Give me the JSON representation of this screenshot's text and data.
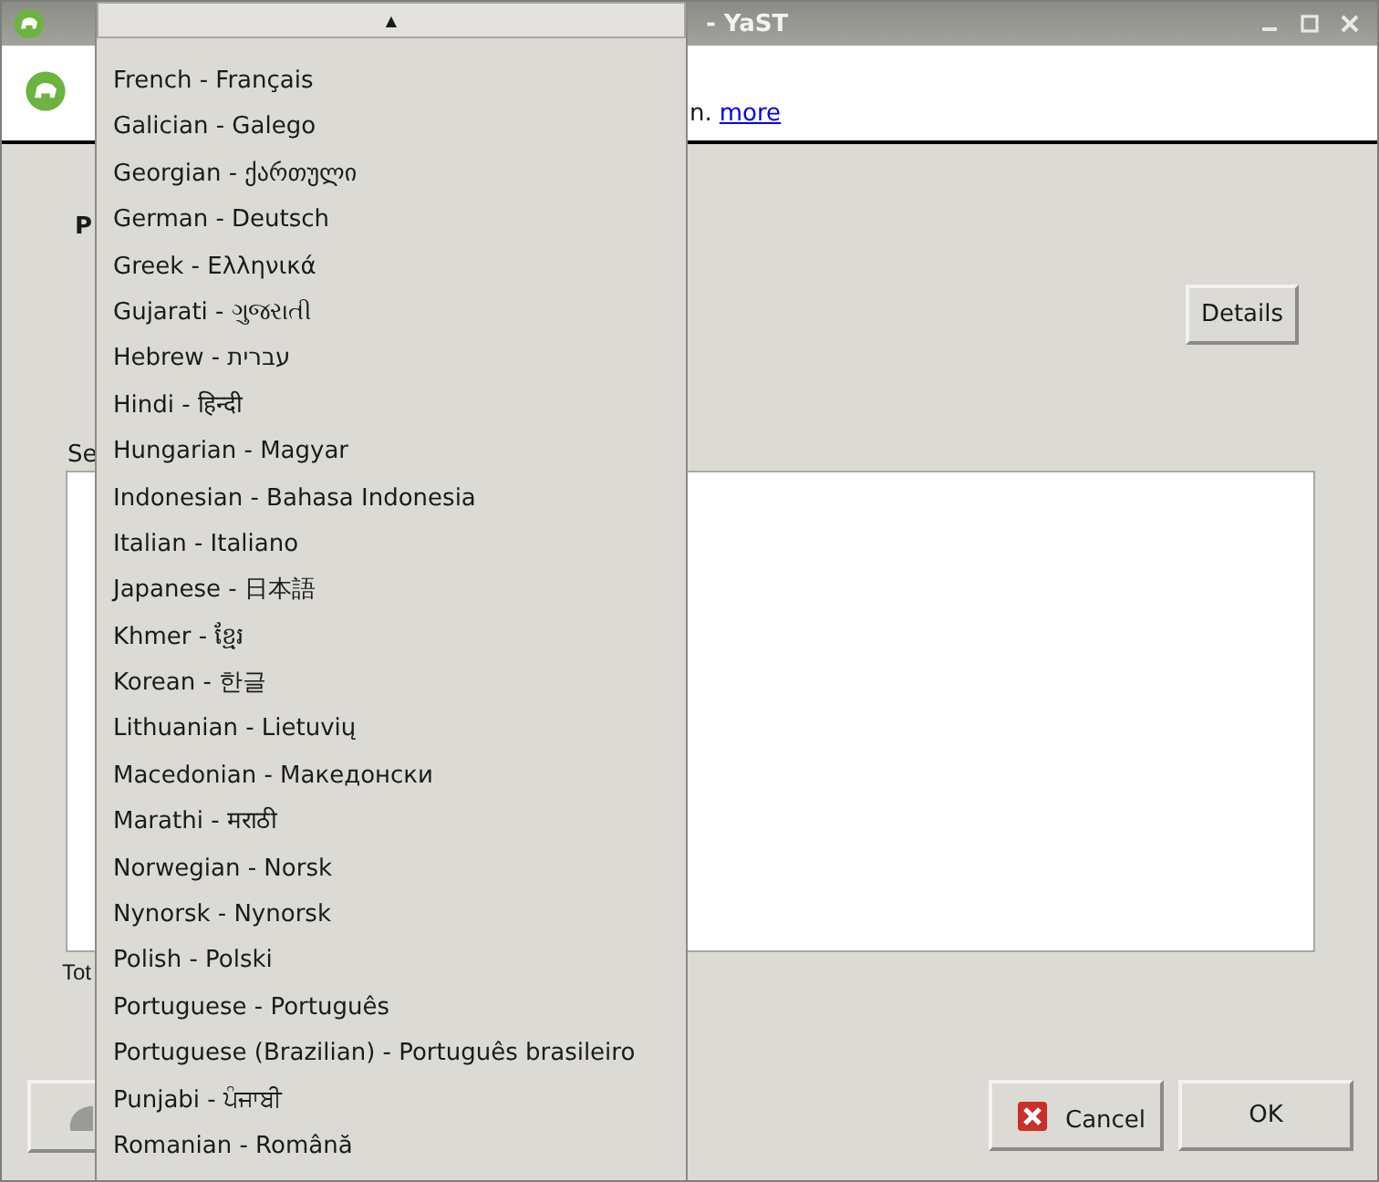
{
  "window": {
    "title": "- YaST"
  },
  "header": {
    "text_fragment": "n.",
    "link": "more"
  },
  "labels": {
    "top_label": "P",
    "list_label": "Se",
    "total_label": "Tot"
  },
  "details_button": "Details",
  "buttons": {
    "cancel": "Cancel",
    "ok": "OK"
  },
  "language_dropdown": {
    "scroll_arrow": "▲",
    "items": [
      "French - Français",
      "Galician - Galego",
      "Georgian - ქართული",
      "German - Deutsch",
      "Greek - Ελληνικά",
      "Gujarati - ગુજરાતી",
      "Hebrew - עברית",
      "Hindi - हिन्दी",
      "Hungarian - Magyar",
      "Indonesian - Bahasa Indonesia",
      "Italian - Italiano",
      "Japanese - 日本語",
      "Khmer - ខ្មែរ",
      "Korean - 한글",
      "Lithuanian - Lietuvių",
      "Macedonian - Македонски",
      "Marathi - मराठी",
      "Norwegian - Norsk",
      "Nynorsk - Nynorsk",
      "Polish - Polski",
      "Portuguese - Português",
      "Portuguese (Brazilian) - Português brasileiro",
      "Punjabi - ਪੰਜਾਬੀ",
      "Romanian - Română"
    ]
  }
}
